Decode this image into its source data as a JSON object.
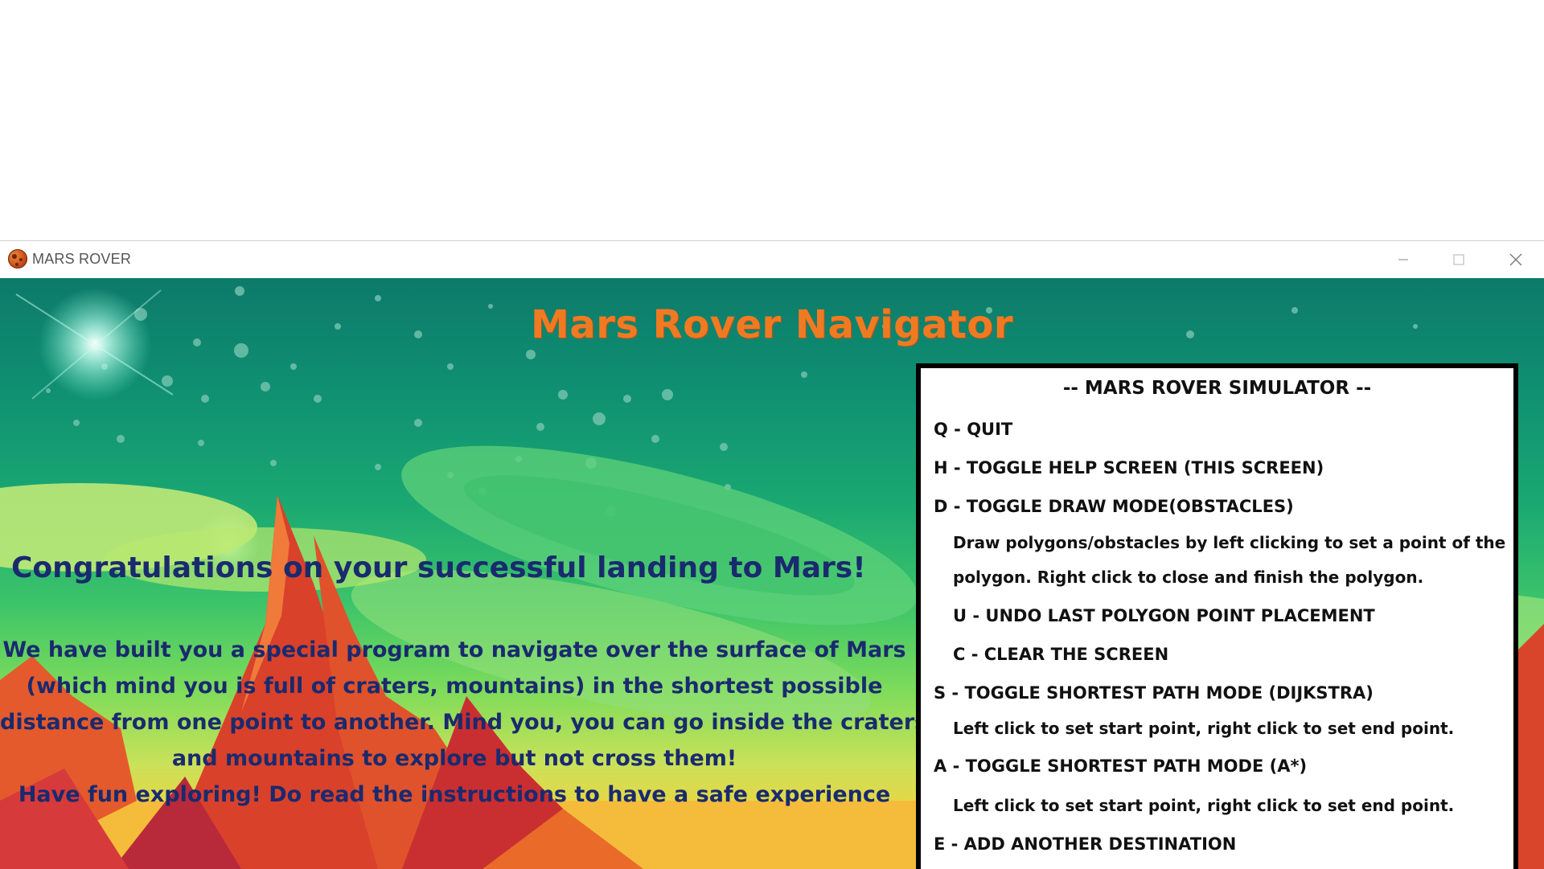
{
  "window": {
    "title": "MARS ROVER",
    "icon": "mars-planet-icon",
    "controls": [
      "minimize-icon",
      "maximize-icon",
      "close-icon"
    ]
  },
  "app": {
    "heading": "Mars Rover Navigator",
    "congrats": "Congratulations on your successful landing to Mars!",
    "intro_lines": [
      "We have built you a special program to navigate over the surface of Mars",
      "(which mind you is full of craters, mountains) in the  shortest possible",
      "distance from one point to another. Mind you, you can go inside the craters",
      "and mountains to explore but not cross them!",
      "Have fun exploring! Do read the instructions to have a safe experience"
    ]
  },
  "help": {
    "title": "-- MARS ROVER SIMULATOR --",
    "quit": "Q - QUIT",
    "toggle_help": "H - TOGGLE HELP SCREEN (THIS SCREEN)",
    "draw_mode": "D - TOGGLE DRAW MODE(OBSTACLES)",
    "draw_desc_1": "Draw polygons/obstacles by left clicking to set a point of the",
    "draw_desc_2": "polygon. Right click to close and finish the polygon.",
    "undo": "U - UNDO LAST POLYGON POINT PLACEMENT",
    "clear": "C - CLEAR THE SCREEN",
    "dijkstra": "S - TOGGLE SHORTEST PATH MODE (DIJKSTRA)",
    "dijkstra_desc": "Left click to set start point, right click to set end point.",
    "astar": "A - TOGGLE SHORTEST PATH MODE (A*)",
    "astar_desc": "Left click to set start point, right click to set end point.",
    "add_dest": "E - ADD ANOTHER DESTINATION"
  },
  "colors": {
    "heading": "#f07a22",
    "body_text": "#1a2a6e",
    "panel_border": "#000000",
    "sky_top": "#0d7a6a",
    "mountains": "#d83a2a"
  }
}
